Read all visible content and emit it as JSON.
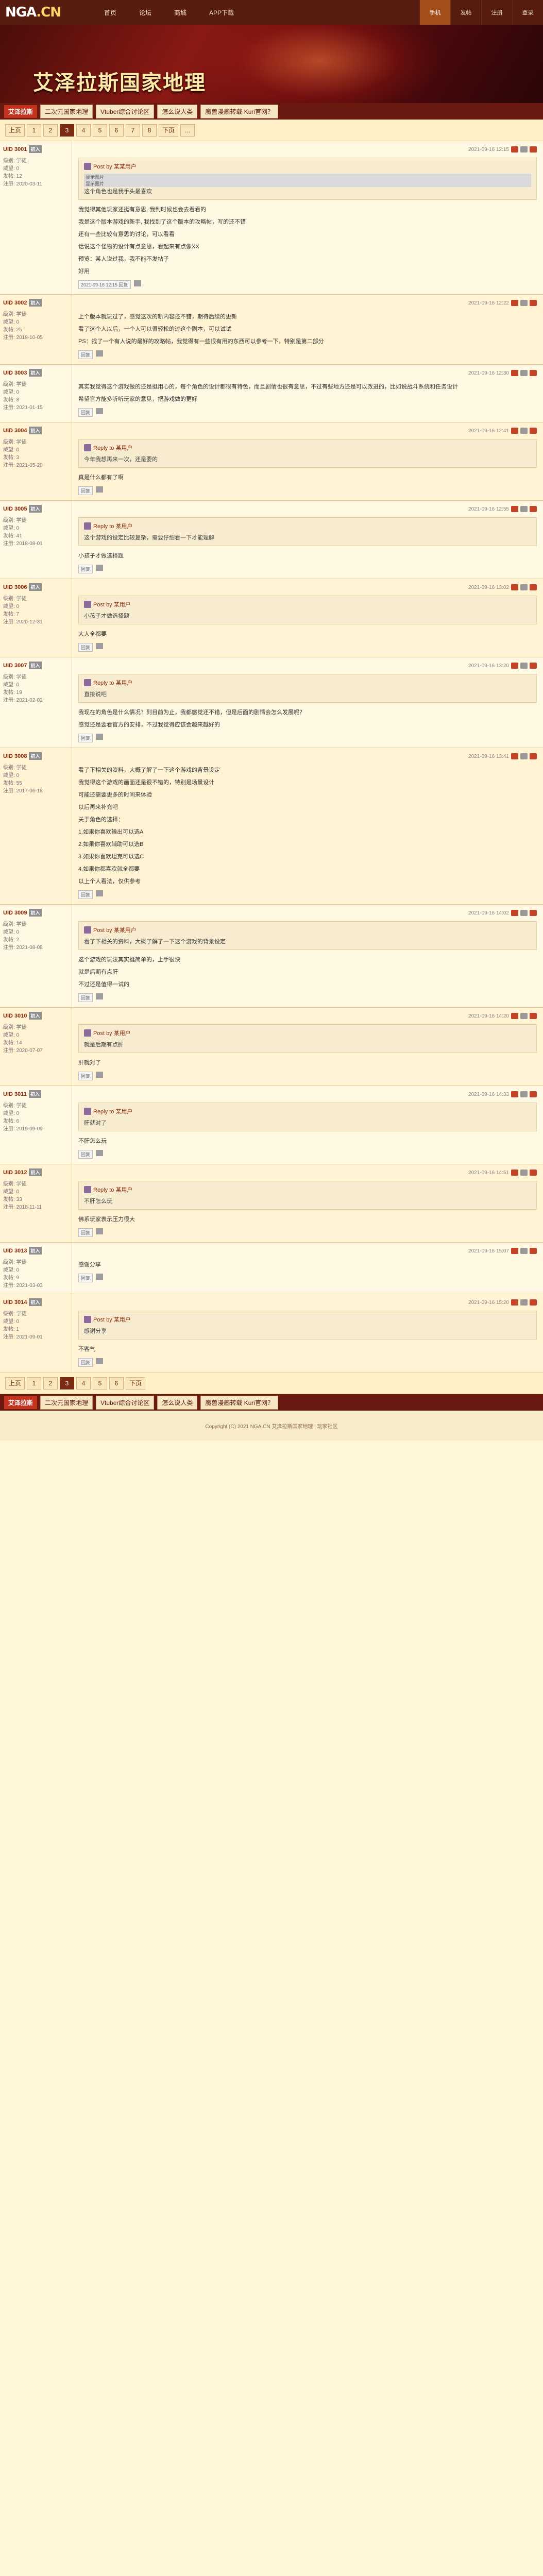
{
  "topbar": {
    "logo_main": "NGA",
    "logo_suffix": ".CN",
    "nav": [
      "首页",
      "论坛",
      "商城",
      "APP下载"
    ],
    "right": [
      "手机",
      "发帖",
      "注册",
      "登录"
    ]
  },
  "banner": {
    "title": "艾泽拉斯国家地理"
  },
  "subbar": {
    "head": "艾泽拉斯",
    "items": [
      "二次元国家地理",
      "Vtuber综合讨论区",
      "怎么说人类",
      "魔兽漫画转载 Kuri官网？"
    ]
  },
  "pager": {
    "prev": "上页",
    "pages": [
      "1",
      "2",
      "3",
      "4",
      "5",
      "6",
      "7",
      "8"
    ],
    "current_index": 2,
    "next": "下页",
    "jump": "..."
  },
  "posts": [
    {
      "user": "UID 3001",
      "badge": "初入",
      "stats": [
        "级别: 学徒",
        "威望: 0",
        "发帖: 12",
        "注册: 2020-03-11"
      ],
      "time": "2021-09-16 12:15",
      "quote_user": "Post by 某某用户",
      "quote_pills": [
        "显示图片",
        "显示图片"
      ],
      "quote_text": "这个角色也是我手头最喜欢",
      "text": [
        "我觉得其他玩家还挺有意思, 我到时候也会去看看的",
        "我是这个版本游戏的新手, 我找到了这个版本的攻略帖，写的还不错",
        "还有一些比较有意思的讨论，可以看看",
        "话说这个怪物的设计有点意思，看起来有点像XX",
        "预览：某人说过我，我不能不发帖子",
        "好用"
      ],
      "sig": "2021-09-16 12:15 回复"
    },
    {
      "user": "UID 3002",
      "badge": "初入",
      "stats": [
        "级别: 学徒",
        "威望: 0",
        "发帖: 25",
        "注册: 2019-10-05"
      ],
      "time": "2021-09-16 12:22",
      "text": [
        "上个版本就玩过了，感觉这次的新内容还不错，期待后续的更新",
        "看了这个人以后，一个人可以很轻松的过这个副本，可以试试",
        "PS：找了一个有人说的最好的攻略帖，我觉得有一些很有用的东西可以参考一下，特别是第二部分"
      ],
      "sig": "回复"
    },
    {
      "user": "UID 3003",
      "badge": "初入",
      "stats": [
        "级别: 学徒",
        "威望: 0",
        "发帖: 8",
        "注册: 2021-01-15"
      ],
      "time": "2021-09-16 12:30",
      "text": [
        "其实我觉得这个游戏做的还是挺用心的，每个角色的设计都很有特色，而且剧情也很有意思，不过有些地方还是可以改进的，比如说战斗系统和任务设计",
        "希望官方能多听听玩家的意见，把游戏做的更好"
      ],
      "sig": "回复"
    },
    {
      "user": "UID 3004",
      "badge": "初入",
      "stats": [
        "级别: 学徒",
        "威望: 0",
        "发帖: 3",
        "注册: 2021-05-20"
      ],
      "time": "2021-09-16 12:41",
      "quote_user": "Reply to 某用户",
      "quote_text": "今年我想再来一次，还是要的",
      "text": [
        "真是什么都有了啊"
      ],
      "sig": "回复"
    },
    {
      "user": "UID 3005",
      "badge": "初入",
      "stats": [
        "级别: 学徒",
        "威望: 0",
        "发帖: 41",
        "注册: 2018-08-01"
      ],
      "time": "2021-09-16 12:55",
      "quote_user": "Reply to 某用户",
      "quote_text": "这个游戏的设定比较复杂，需要仔细看一下才能理解",
      "text": [
        "小孩子才做选择题"
      ],
      "sig": "回复"
    },
    {
      "user": "UID 3006",
      "badge": "初入",
      "stats": [
        "级别: 学徒",
        "威望: 0",
        "发帖: 7",
        "注册: 2020-12-31"
      ],
      "time": "2021-09-16 13:02",
      "quote_user": "Post by 某用户",
      "quote_text": "小孩子才做选择题",
      "text": [
        "大人全都要"
      ],
      "sig": "回复"
    },
    {
      "user": "UID 3007",
      "badge": "初入",
      "stats": [
        "级别: 学徒",
        "威望: 0",
        "发帖: 19",
        "注册: 2021-02-02"
      ],
      "time": "2021-09-16 13:20",
      "quote_user": "Reply to 某用户",
      "quote_text": "直接说吧",
      "text": [
        "我现在的角色是什么情况？到目前为止，我都感觉还不错，但是后面的剧情会怎么发展呢？",
        "感觉还是要看官方的安排，不过我觉得应该会越来越好的"
      ],
      "sig": "回复"
    },
    {
      "user": "UID 3008",
      "badge": "初入",
      "stats": [
        "级别: 学徒",
        "威望: 0",
        "发帖: 55",
        "注册: 2017-06-18"
      ],
      "time": "2021-09-16 13:41",
      "text": [
        "看了下相关的资料，大概了解了一下这个游戏的背景设定",
        "我觉得这个游戏的画面还是很不错的，特别是场景设计",
        "可能还需要更多的时间来体验",
        "以后再来补充吧",
        "关于角色的选择：",
        "1.如果你喜欢输出可以选A",
        "2.如果你喜欢辅助可以选B",
        "3.如果你喜欢坦克可以选C",
        "4.如果你都喜欢就全都要",
        "以上个人看法，仅供参考"
      ],
      "sig": "回复"
    },
    {
      "user": "UID 3009",
      "badge": "初入",
      "stats": [
        "级别: 学徒",
        "威望: 0",
        "发帖: 2",
        "注册: 2021-08-08"
      ],
      "time": "2021-09-16 14:02",
      "quote_user": "Post by 某某用户",
      "quote_text": "看了下相关的资料，大概了解了一下这个游戏的背景设定",
      "text": [
        "这个游戏的玩法其实挺简单的，上手很快",
        "就是后期有点肝",
        "不过还是值得一试的"
      ],
      "sig": "回复"
    },
    {
      "user": "UID 3010",
      "badge": "初入",
      "stats": [
        "级别: 学徒",
        "威望: 0",
        "发帖: 14",
        "注册: 2020-07-07"
      ],
      "time": "2021-09-16 14:20",
      "quote_user": "Post by 某用户",
      "quote_text": "就是后期有点肝",
      "text": [
        "肝就对了"
      ],
      "sig": "回复"
    },
    {
      "user": "UID 3011",
      "badge": "初入",
      "stats": [
        "级别: 学徒",
        "威望: 0",
        "发帖: 6",
        "注册: 2019-09-09"
      ],
      "time": "2021-09-16 14:33",
      "quote_user": "Reply to 某用户",
      "quote_text": "肝就对了",
      "text": [
        "不肝怎么玩"
      ],
      "sig": "回复"
    },
    {
      "user": "UID 3012",
      "badge": "初入",
      "stats": [
        "级别: 学徒",
        "威望: 0",
        "发帖: 33",
        "注册: 2018-11-11"
      ],
      "time": "2021-09-16 14:51",
      "quote_user": "Reply to 某用户",
      "quote_text": "不肝怎么玩",
      "text": [
        "佛系玩家表示压力很大"
      ],
      "sig": "回复"
    },
    {
      "user": "UID 3013",
      "badge": "初入",
      "stats": [
        "级别: 学徒",
        "威望: 0",
        "发帖: 9",
        "注册: 2021-03-03"
      ],
      "time": "2021-09-16 15:07",
      "text": [
        "感谢分享"
      ],
      "sig": "回复"
    },
    {
      "user": "UID 3014",
      "badge": "初入",
      "stats": [
        "级别: 学徒",
        "威望: 0",
        "发帖: 1",
        "注册: 2021-09-01"
      ],
      "time": "2021-09-16 15:20",
      "quote_user": "Post by 某用户",
      "quote_text": "感谢分享",
      "text": [
        "不客气"
      ],
      "sig": "回复"
    }
  ],
  "footer": {
    "text": "Copyright (C) 2021 NGA.CN 艾泽拉斯国家地理 | 玩家社区"
  }
}
